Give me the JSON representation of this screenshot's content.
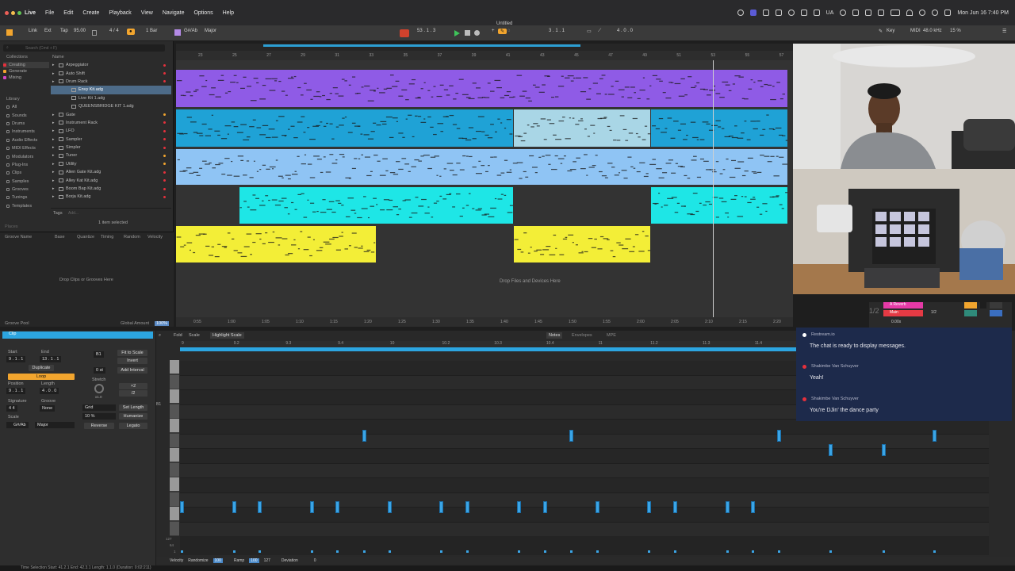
{
  "menubar": {
    "apple": "",
    "items": [
      "Live",
      "File",
      "Edit",
      "Create",
      "Playback",
      "View",
      "Navigate",
      "Options",
      "Help"
    ],
    "clock": "Mon Jun 16  7:40 PM",
    "input_label": "UA"
  },
  "transport": {
    "title": "Untitled",
    "link": "Link",
    "ext": "Ext",
    "tap": "Tap",
    "tempo": "95.00",
    "time_sig": "4 / 4",
    "bar": "1 Bar",
    "scale_root": "G#/Ab",
    "scale_name": "Major",
    "position": "53 .  1 .  3",
    "loop_start": "3 .  1 .  1",
    "loop_end": "4 .  0 .  0",
    "key": "Key",
    "midi": "MIDI",
    "sample_rate": "48.0 kHz",
    "cpu": "15 %"
  },
  "browser": {
    "search_placeholder": "Search (Cmd + F)",
    "collections_head": "Collections",
    "collections": [
      {
        "label": "Creating",
        "color": "#e5303c",
        "selected": true
      },
      {
        "label": "Generate",
        "color": "#f2a52e"
      },
      {
        "label": "Mixing",
        "color": "#d648c6"
      }
    ],
    "library_head": "Library",
    "library": [
      "All",
      "Sounds",
      "Drums",
      "Instruments",
      "Audio Effects",
      "MIDI Effects",
      "Modulators",
      "Plug-Ins",
      "Clips",
      "Samples",
      "Grooves",
      "Tunings",
      "Templates"
    ],
    "name_head": "Name",
    "files": [
      {
        "label": "Arpeggiator",
        "dot": "r"
      },
      {
        "label": "Auto Shift",
        "dot": "r"
      },
      {
        "label": "Drum Rack",
        "dot": "r"
      },
      {
        "label": "Envy Kit.adg",
        "indent": true,
        "selected": true
      },
      {
        "label": "Live Kit 1.adg",
        "indent": true
      },
      {
        "label": "QUEENSBRIDGE KIT 1.adg",
        "indent": true
      },
      {
        "label": "Gate",
        "dot": "o"
      },
      {
        "label": "Instrument Rack",
        "dot": "r"
      },
      {
        "label": "LFO",
        "dot": "r"
      },
      {
        "label": "Sampler",
        "dot": "r"
      },
      {
        "label": "Simpler",
        "dot": "r"
      },
      {
        "label": "Tuner",
        "dot": "o"
      },
      {
        "label": "Utility",
        "dot": "o"
      },
      {
        "label": "Alien Gate Kit.adg",
        "dot": "r"
      },
      {
        "label": "Alley Kat Kit.adg",
        "dot": "r"
      },
      {
        "label": "Boom Bap Kit.adg",
        "dot": "r"
      },
      {
        "label": "Borja Kit.adg",
        "dot": "r"
      }
    ],
    "tags": "Tags",
    "tags_placeholder": "Add...",
    "selected_count": "1 item selected",
    "places": "Places",
    "groove_cols": [
      "Groove Name",
      "Base",
      "Quantize",
      "Timing",
      "Random",
      "Velocity"
    ],
    "groove_hint": "Drop Clips or Grooves Here",
    "groove_pool": "Groove Pool",
    "global_amount": "Global Amount",
    "global_amount_value": "100%"
  },
  "arrangement": {
    "bars": [
      "23",
      "25",
      "27",
      "29",
      "31",
      "33",
      "35",
      "37",
      "39",
      "41",
      "43",
      "45",
      "47",
      "49",
      "51",
      "53",
      "55",
      "57"
    ],
    "times": [
      "0:55",
      "1:00",
      "1:05",
      "1:10",
      "1:15",
      "1:20",
      "1:25",
      "1:30",
      "1:35",
      "1:40",
      "1:45",
      "1:50",
      "1:55",
      "2:00",
      "2:05",
      "2:10",
      "2:15",
      "2:20"
    ],
    "drop_hint": "Drop Files and Devices Here",
    "tracks": [
      {
        "color": "#8f5be6"
      },
      {
        "color": "#1fa2d6"
      },
      {
        "color": "#8fc4f4"
      },
      {
        "color": "#1ee6e6"
      },
      {
        "color": "#f3ee37"
      }
    ]
  },
  "clip": {
    "header": "Clip",
    "start": "Start",
    "start_val": "9 .  1 .  1",
    "end": "End",
    "end_val": "13 .  1 .  1",
    "set": "Set",
    "duplicate": "Duplicate",
    "loop": "Loop",
    "position": "Position",
    "position_val": "9 .  1 .  1",
    "length": "Length",
    "length_val": "4 .  0 .  0",
    "signature": "Signature",
    "signature_val": "4    4",
    "groove": "Groove",
    "groove_val": "None",
    "scale": "Scale",
    "scale_root": "G#/Ab",
    "scale_name": "Major",
    "pitch": "B1",
    "fit_to_scale": "Fit to Scale",
    "invert": "Invert",
    "add_interval": "Add Interval",
    "semitone": "0 st",
    "stretch": "Stretch",
    "stretch_val": "x1.0",
    "times2": "×2",
    "div2": "/2",
    "grid": "Grid",
    "set_length": "Set Length",
    "humanize": "Humanize",
    "percent": "10 %",
    "reverse": "Reverse",
    "legato": "Legato"
  },
  "roll": {
    "tabs": [
      "Fold",
      "Scale",
      "Highlight Scale"
    ],
    "right_tabs": [
      "Notes",
      "Envelopes",
      "MPE"
    ],
    "ruler": [
      "9",
      "9.2",
      "9.3",
      "9.4",
      "10",
      "10.2",
      "10.3",
      "10.4",
      "11",
      "11.2",
      "11.3",
      "11.4"
    ],
    "key_label": "B1",
    "velocity": "Velocity",
    "randomize": "Randomize",
    "randomize_val": "100",
    "ramp": "Ramp",
    "ramp_val": "100",
    "ramp_val2": "127",
    "deviation": "Deviation",
    "deviation_val": "0",
    "vel_max": "127",
    "vel_mid": "64",
    "vel_min": "1"
  },
  "chat": {
    "header_name": "Restream.io",
    "system_msg": "The chat is ready to display messages.",
    "messages": [
      {
        "name": "Shakimbe Van Schuyver",
        "text": "Yeah!"
      },
      {
        "name": "Shakimbe Van Schuyver",
        "text": "You're DJin' the dance party"
      }
    ]
  },
  "mixer": {
    "reverb": "A Reverb",
    "main": "Main",
    "fraction": "1/2",
    "speed": "0.00x"
  },
  "status": {
    "selection": "Time Selection  Start: 41.2.1   End: 42.3.1   Length: 1.1.0  (Duration: 0:02:211)"
  }
}
